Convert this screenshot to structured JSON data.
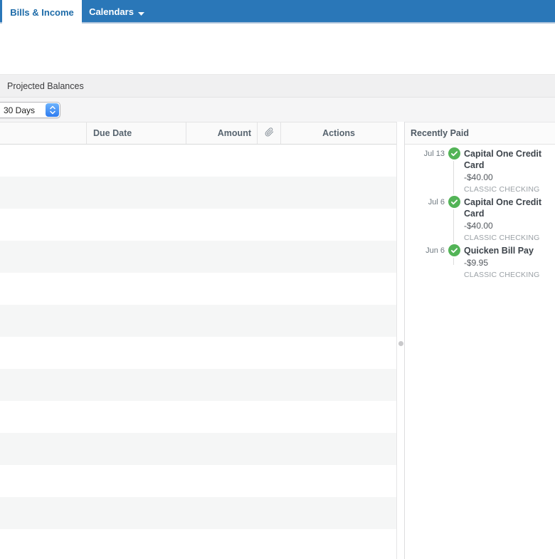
{
  "tabs": {
    "bills_income": "Bills & Income",
    "calendars": "Calendars"
  },
  "section": {
    "title": "Projected Balances"
  },
  "toolbar": {
    "range_select_value": "30 Days"
  },
  "bills_table": {
    "columns": {
      "name": "",
      "due_date": "Due Date",
      "amount": "Amount",
      "attachment_icon": "paperclip-icon",
      "actions": "Actions"
    },
    "rows": []
  },
  "recently_paid": {
    "title": "Recently Paid",
    "entries": [
      {
        "date": "Jul 13",
        "status_icon": "green-check",
        "name": "Capital One Credit Card",
        "amount": "-$40.00",
        "account": "CLASSIC CHECKING"
      },
      {
        "date": "Jul 6",
        "status_icon": "green-check",
        "name": "Capital One Credit Card",
        "amount": "-$40.00",
        "account": "CLASSIC CHECKING"
      },
      {
        "date": "Jun 6",
        "status_icon": "green-check",
        "name": "Quicken Bill Pay",
        "amount": "-$9.95",
        "account": "CLASSIC CHECKING"
      }
    ]
  },
  "colors": {
    "tabbar_blue": "#2a77b8",
    "active_tab_text": "#1d6ba8",
    "tabbar_border": "#abc2db",
    "stepper_blue": "#2e7cf0",
    "paid_green": "#53b457",
    "stripe_gray": "#f5f6f6"
  }
}
